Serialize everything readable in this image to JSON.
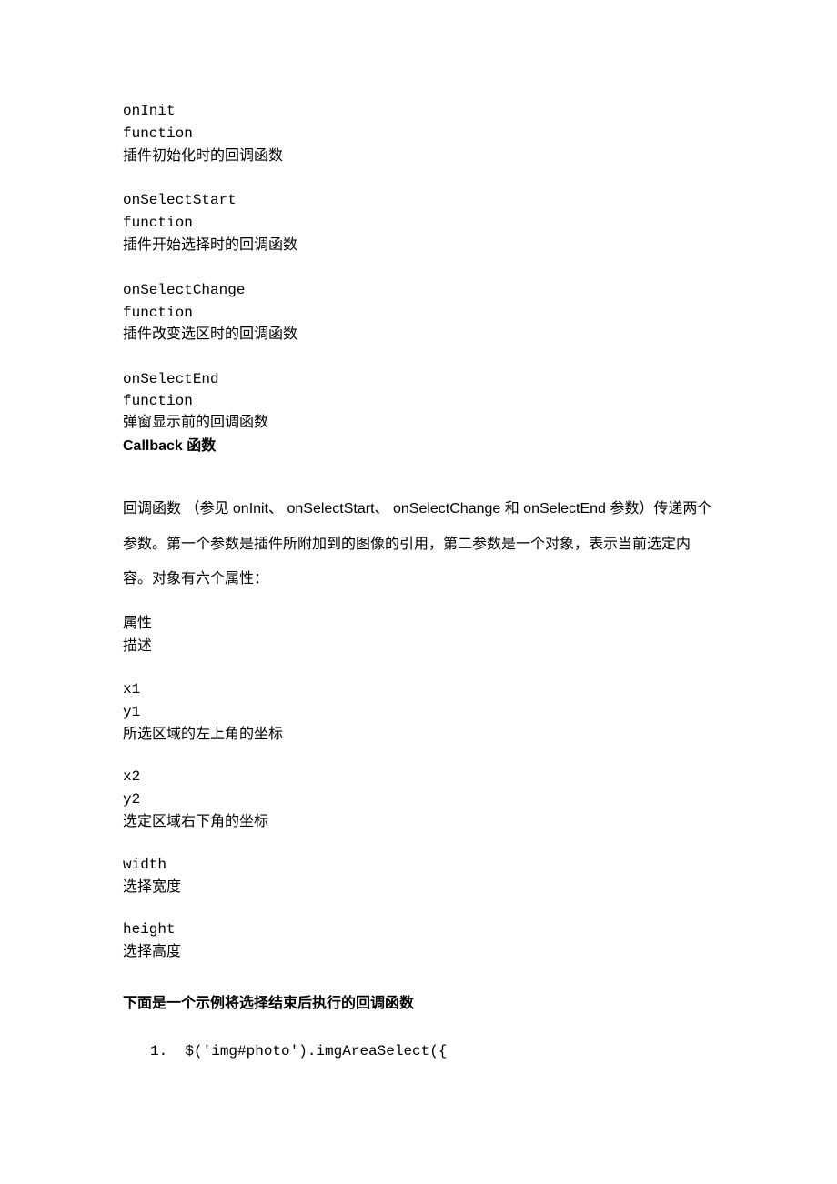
{
  "callbacks": [
    {
      "name": "onInit",
      "type": "function",
      "desc": "插件初始化时的回调函数"
    },
    {
      "name": "onSelectStart",
      "type": "function",
      "desc": "插件开始选择时的回调函数"
    },
    {
      "name": "onSelectChange",
      "type": "function",
      "desc": "插件改变选区时的回调函数"
    },
    {
      "name": "onSelectEnd",
      "type": "function",
      "desc": "弹窗显示前的回调函数"
    }
  ],
  "callback_heading": "Callback 函数",
  "intro": "回调函数 （参见 onInit、 onSelectStart、 onSelectChange 和 onSelectEnd 参数）传递两个参数。第一个参数是插件所附加到的图像的引用，第二参数是一个对象，表示当前选定内容。对象有六个属性：",
  "prop_header": {
    "attr": "属性",
    "desc": "描述"
  },
  "props": [
    {
      "lines": [
        "x1",
        "y1"
      ],
      "desc": "所选区域的左上角的坐标"
    },
    {
      "lines": [
        "x2",
        "y2"
      ],
      "desc": "选定区域右下角的坐标"
    },
    {
      "lines": [
        "width"
      ],
      "desc": "选择宽度"
    },
    {
      "lines": [
        "height"
      ],
      "desc": "选择高度"
    }
  ],
  "example_heading": "下面是一个示例将选择结束后执行的回调函数",
  "code": {
    "num": "1.",
    "text": "$('img#photo').imgAreaSelect({"
  }
}
